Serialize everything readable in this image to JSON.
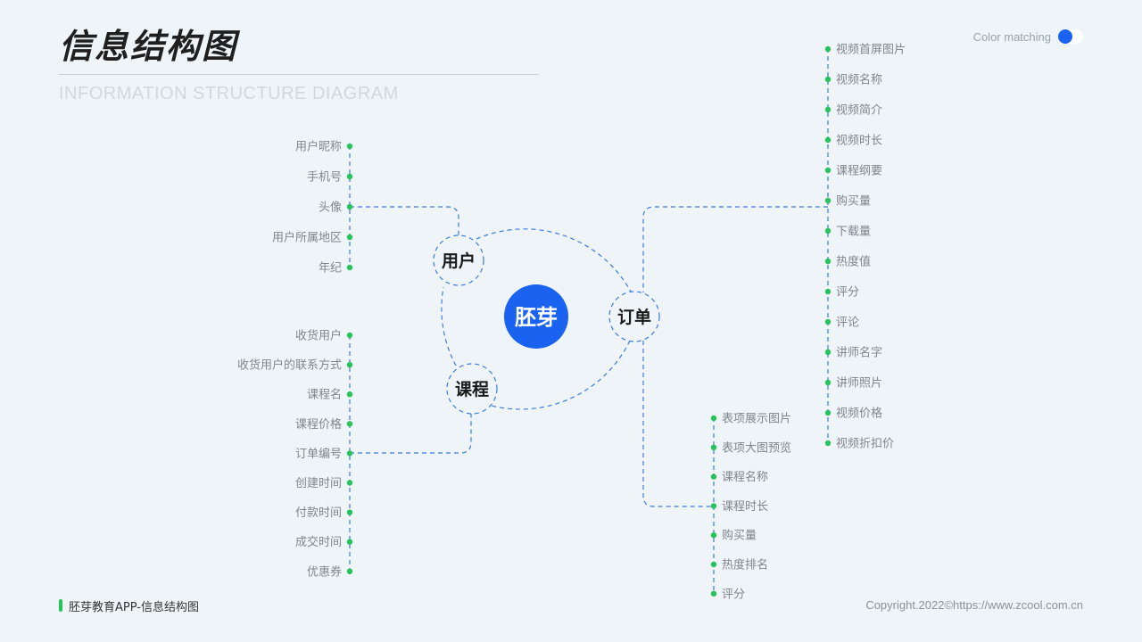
{
  "header": {
    "title": "信息结构图",
    "subtitle": "INFORMATION STRUCTURE DIAGRAM",
    "color_matching_label": "Color matching"
  },
  "footer": {
    "title": "胚芽教育APP-信息结构图",
    "copyright": "Copyright.2022©https://www.zcool.com.cn"
  },
  "colors": {
    "accent": "#1a63f0",
    "dot": "#27c45c",
    "line": "#3b7de0",
    "background": "#eef4f7"
  },
  "diagram": {
    "center": "胚芽",
    "nodes": {
      "user": {
        "label": "用户",
        "items": [
          "用户昵称",
          "手机号",
          "头像",
          "用户所属地区",
          "年纪"
        ]
      },
      "course": {
        "label": "课程",
        "items": [
          "收货用户",
          "收货用户的联系方式",
          "课程名",
          "课程价格",
          "订单编号",
          "创建时间",
          "付款时间",
          "成交时间",
          "优惠券"
        ]
      },
      "order": {
        "label": "订单",
        "items_upper": [
          "视频首屏图片",
          "视频名称",
          "视频简介",
          "视频时长",
          "课程纲要",
          "购买量",
          "下载量",
          "热度值",
          "评分",
          "评论",
          "讲师名字",
          "讲师照片",
          "视频价格",
          "视频折扣价"
        ],
        "items_lower": [
          "表项展示图片",
          "表项大图预览",
          "课程名称",
          "课程时长",
          "购买量",
          "热度排名",
          "评分"
        ]
      }
    }
  }
}
